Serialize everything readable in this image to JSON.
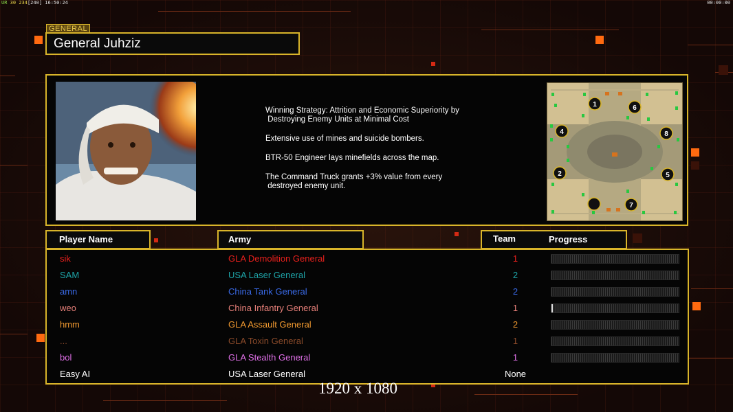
{
  "topbar": {
    "left_prefix": "UR",
    "left_value1": "30",
    "left_value2": "234",
    "left_value3": "[240]",
    "left_time": "16:50:24",
    "right_time": "00:00:00"
  },
  "general": {
    "tab_label": "GENERAL",
    "name": "General Juhziz",
    "description": [
      "Winning Strategy: Attrition and Economic Superiority by\n Destroying Enemy Units at Minimal Cost",
      "Extensive use of mines and suicide bombers.",
      "BTR-50 Engineer lays minefields across the map.",
      "The Command Truck grants +3% value from every\n destroyed enemy unit."
    ]
  },
  "minimap": {
    "start_positions": [
      "1",
      "6",
      "4",
      "8",
      "2",
      "5",
      "7"
    ]
  },
  "table": {
    "headers": {
      "player": "Player Name",
      "army": "Army",
      "team": "Team",
      "progress": "Progress"
    },
    "rows": [
      {
        "name": "sik",
        "army": "GLA Demolition General",
        "team": "1",
        "color": "#e8201c",
        "progress": 0
      },
      {
        "name": "SAM",
        "army": "USA Laser General",
        "team": "2",
        "color": "#1ea4a8",
        "progress": 0
      },
      {
        "name": "amn",
        "army": "China Tank General",
        "team": "2",
        "color": "#3a6ae8",
        "progress": 0
      },
      {
        "name": "weo",
        "army": "China Infantry General",
        "team": "1",
        "color": "#e8807a",
        "progress": 0.01
      },
      {
        "name": "hmm",
        "army": "GLA Assault General",
        "team": "2",
        "color": "#f29a30",
        "progress": 0
      },
      {
        "name": "...",
        "army": "GLA Toxin General",
        "team": "1",
        "color": "#8a4a2a",
        "progress": 0
      },
      {
        "name": "bol",
        "army": "GLA Stealth General",
        "team": "1",
        "color": "#e070e8",
        "progress": 0
      },
      {
        "name": "Easy AI",
        "army": "USA Laser General",
        "team": "None",
        "color": "#ffffff",
        "progress": null
      }
    ]
  },
  "caption": "1920 x 1080"
}
